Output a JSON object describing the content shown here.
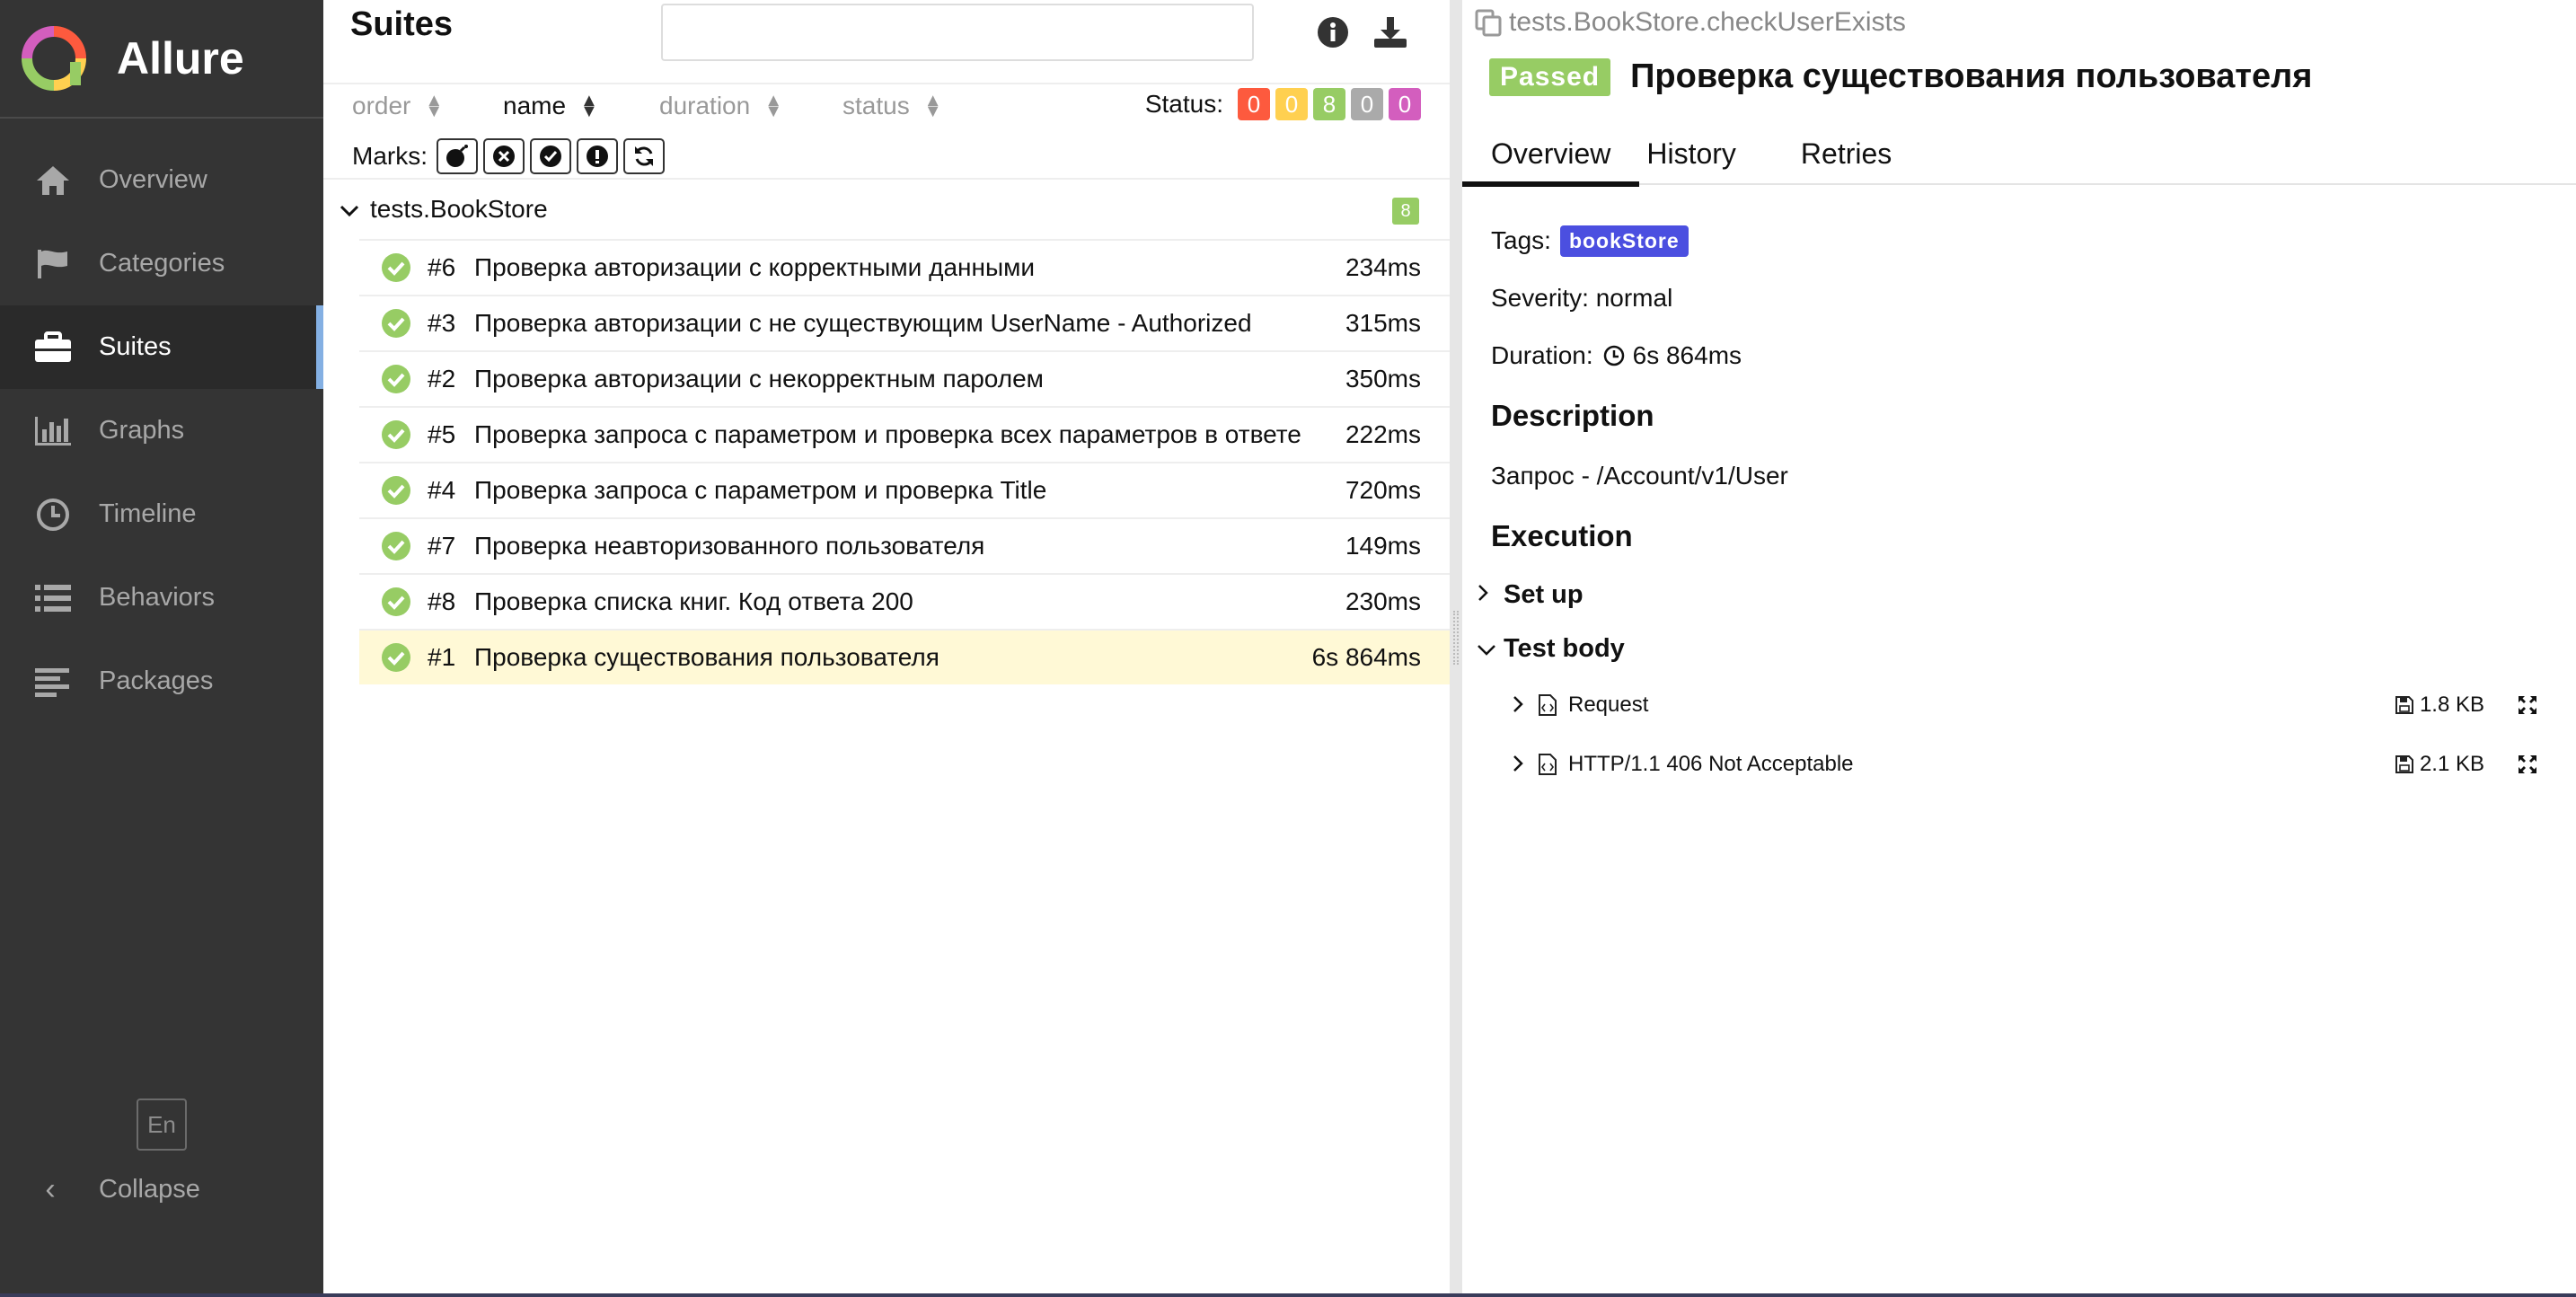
{
  "brand": {
    "name": "Allure"
  },
  "sidebar": {
    "items": [
      {
        "label": "Overview",
        "icon": "home-icon"
      },
      {
        "label": "Categories",
        "icon": "flag-icon"
      },
      {
        "label": "Suites",
        "icon": "briefcase-icon",
        "active": true
      },
      {
        "label": "Graphs",
        "icon": "bar-chart-icon"
      },
      {
        "label": "Timeline",
        "icon": "clock-icon"
      },
      {
        "label": "Behaviors",
        "icon": "list-icon"
      },
      {
        "label": "Packages",
        "icon": "align-left-icon"
      }
    ],
    "language": "En",
    "collapse_label": "Collapse"
  },
  "suites": {
    "title": "Suites",
    "search_placeholder": "",
    "sort": {
      "order": "order",
      "name": "name",
      "duration": "duration",
      "status": "status"
    },
    "status_label": "Status:",
    "status_counts": [
      {
        "value": "0",
        "color": "#fd5a3e"
      },
      {
        "value": "0",
        "color": "#ffd050"
      },
      {
        "value": "8",
        "color": "#97cc64"
      },
      {
        "value": "0",
        "color": "#aaaaaa"
      },
      {
        "value": "0",
        "color": "#d35ebe"
      }
    ],
    "marks_label": "Marks:",
    "group": {
      "name": "tests.BookStore",
      "count": "8"
    },
    "rows": [
      {
        "num": "#6",
        "name": "Проверка авторизации с корректными данными",
        "duration": "234ms"
      },
      {
        "num": "#3",
        "name": "Проверка авторизации с не существующим UserName - Authorized",
        "duration": "315ms"
      },
      {
        "num": "#2",
        "name": "Проверка авторизации с некорректным паролем",
        "duration": "350ms"
      },
      {
        "num": "#5",
        "name": "Проверка запроса с параметром и проверка всех параметров в ответе",
        "duration": "222ms"
      },
      {
        "num": "#4",
        "name": "Проверка запроса с параметром и проверка Title",
        "duration": "720ms"
      },
      {
        "num": "#7",
        "name": "Проверка неавторизованного пользователя",
        "duration": "149ms"
      },
      {
        "num": "#8",
        "name": "Проверка списка книг. Код ответа 200",
        "duration": "230ms"
      },
      {
        "num": "#1",
        "name": "Проверка существования пользователя",
        "duration": "6s 864ms",
        "selected": true
      }
    ]
  },
  "detail": {
    "path": "tests.BookStore.checkUserExists",
    "status": "Passed",
    "title": "Проверка существования пользователя",
    "tabs": [
      "Overview",
      "History",
      "Retries"
    ],
    "tags_label": "Tags:",
    "tag": "bookStore",
    "severity": "Severity: normal",
    "duration_label": "Duration:",
    "duration": "6s 864ms",
    "description_heading": "Description",
    "description": "Запрос - /Account/v1/User",
    "execution_heading": "Execution",
    "setup_label": "Set up",
    "test_body_label": "Test body",
    "attachments": [
      {
        "name": "Request",
        "size": "1.8 KB"
      },
      {
        "name": "HTTP/1.1 406 Not Acceptable",
        "size": "2.1 KB"
      }
    ]
  }
}
